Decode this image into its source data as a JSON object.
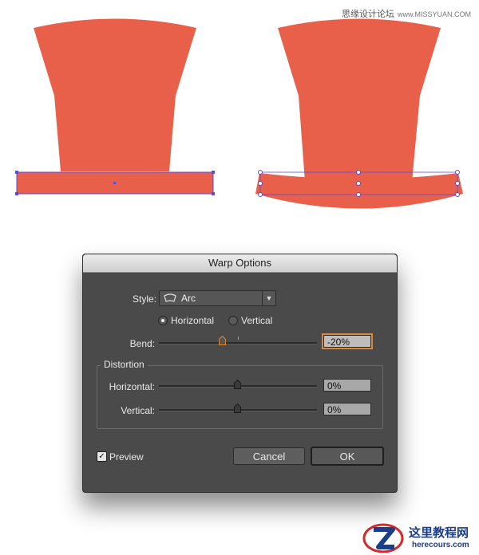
{
  "watermark_top": {
    "cn": "思缘设计论坛",
    "site": "www.MISSYUAN.COM"
  },
  "dialog": {
    "title": "Warp Options",
    "style_label": "Style:",
    "style_value": "Arc",
    "orientation": {
      "horizontal": "Horizontal",
      "vertical": "Vertical",
      "selected": "Horizontal"
    },
    "bend_label": "Bend:",
    "bend_value": "-20%",
    "bend_percent": -20,
    "distortion": {
      "title": "Distortion",
      "horizontal_label": "Horizontal:",
      "horizontal_value": "0%",
      "horizontal_percent": 0,
      "vertical_label": "Vertical:",
      "vertical_value": "0%",
      "vertical_percent": 0
    },
    "preview_label": "Preview",
    "preview_checked": true,
    "cancel_label": "Cancel",
    "ok_label": "OK"
  },
  "colors": {
    "hat": "#e8604a",
    "selection": "#5b4bd6",
    "dialog_bg": "#4a4a4a",
    "focus": "#d88a3a"
  },
  "watermark_bottom": {
    "title": "这里教程网",
    "site": "herecours.com"
  }
}
